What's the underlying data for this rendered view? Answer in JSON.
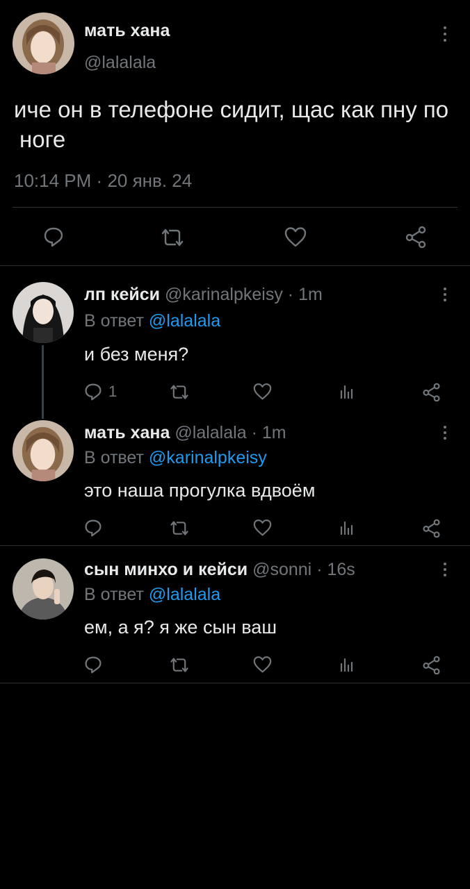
{
  "main": {
    "author_name": "мать хана",
    "author_handle": "@lalalala",
    "text": "иче он в телефоне сидит, щас как пну по ноге",
    "time": "10:14 PM",
    "date": "20 янв. 24"
  },
  "replies": [
    {
      "name": "лп кейси",
      "handle": "@karinalpkeisy",
      "age": "1m",
      "reply_prefix": "В ответ",
      "reply_to": "@lalalala",
      "text": "и без меня?",
      "reply_count": "1"
    },
    {
      "name": "мать хана",
      "handle": "@lalalala",
      "age": "1m",
      "reply_prefix": "В ответ",
      "reply_to": "@karinalpkeisy",
      "text": "это наша прогулка вдвоём",
      "reply_count": ""
    },
    {
      "name": "сын минхо и кейси",
      "handle": "@sonni",
      "age": "16s",
      "reply_prefix": "В ответ",
      "reply_to": "@lalalala",
      "text": "ем, а я? я же сын ваш",
      "reply_count": ""
    }
  ],
  "separator": "·",
  "colors": {
    "background": "#000000",
    "text": "#e7e9ea",
    "muted": "#71767b",
    "link": "#1d9bf0",
    "divider": "#2f3336"
  },
  "icons": [
    "reply-icon",
    "retweet-icon",
    "like-icon",
    "views-icon",
    "share-icon",
    "more-icon"
  ]
}
